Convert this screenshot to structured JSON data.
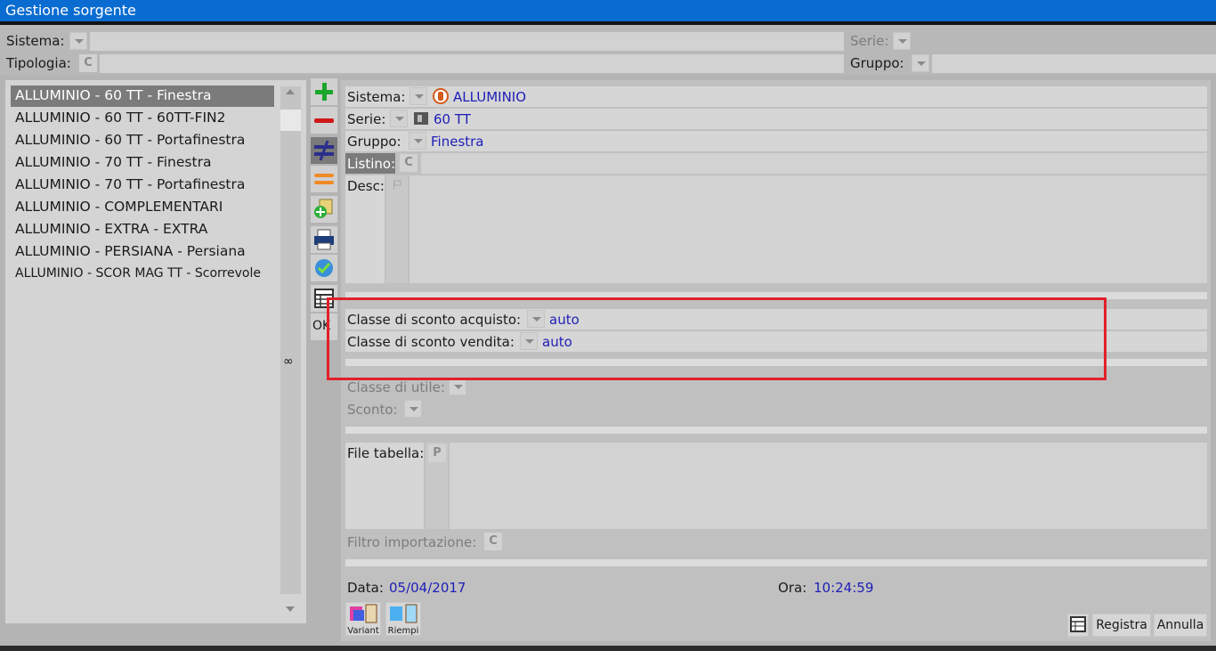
{
  "window": {
    "title": "Gestione sorgente"
  },
  "filters": {
    "sistema_label": "Sistema:",
    "tipologia_label": "Tipologia:",
    "tipologia_btn": "C",
    "serie_label": "Serie:",
    "gruppo_label": "Gruppo:"
  },
  "list": {
    "items": [
      "ALLUMINIO - 60 TT - Finestra",
      "ALLUMINIO - 60 TT - 60TT-FIN2",
      "ALLUMINIO - 60 TT - Portafinestra",
      "ALLUMINIO - 70 TT - Finestra",
      "ALLUMINIO - 70 TT - Portafinestra",
      "ALLUMINIO - COMPLEMENTARI",
      "ALLUMINIO - EXTRA - EXTRA",
      "ALLUMINIO - PERSIANA - Persiana",
      "ALLUMINIO - SCOR MAG TT - Scorrevole"
    ],
    "infinity": "∞"
  },
  "toolbar": {
    "ok_label": "OK"
  },
  "form": {
    "sistema_label": "Sistema:",
    "sistema_value": "ALLUMINIO",
    "serie_label": "Serie:",
    "serie_value": "60 TT",
    "gruppo_label": "Gruppo:",
    "gruppo_value": "Finestra",
    "listino_label": "Listino:",
    "listino_btn": "C",
    "desc_label": "Desc:",
    "sconto_acquisto_label": "Classe di sconto acquisto:",
    "sconto_acquisto_value": "auto",
    "sconto_vendita_label": "Classe di sconto vendita:",
    "sconto_vendita_value": "auto",
    "classe_utile_label": "Classe di utile:",
    "sconto_label": "Sconto:",
    "file_tabella_label": "File tabella:",
    "file_tabella_btn": "P",
    "filtro_label": "Filtro importazione:",
    "filtro_btn": "C",
    "data_label": "Data:",
    "data_value": "05/04/2017",
    "ora_label": "Ora:",
    "ora_value": "10:24:59"
  },
  "bottom": {
    "variant_label": "Variant",
    "riempi_label": "Riempi",
    "registra_label": "Registra",
    "annulla_label": "Annulla"
  },
  "colors": {
    "titlebar": "#0a6cd0",
    "highlight": "#e2202a",
    "value_text": "#1e1eb8"
  }
}
